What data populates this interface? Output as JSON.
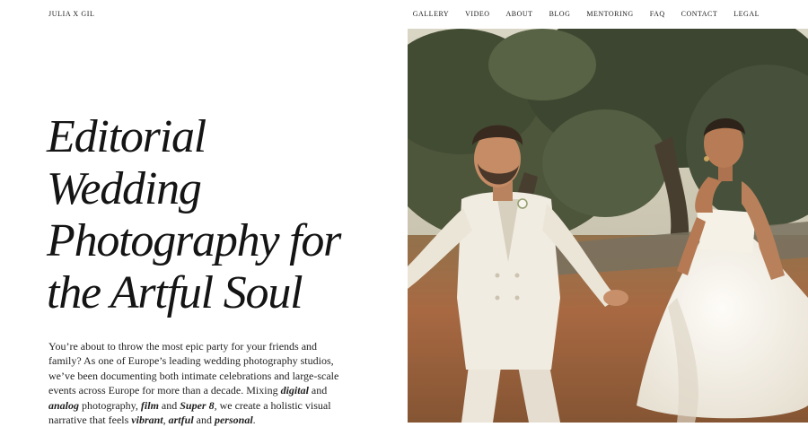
{
  "brand": {
    "logo": "JULIA X GIL"
  },
  "nav": {
    "items": [
      "GALLERY",
      "VIDEO",
      "ABOUT",
      "BLOG",
      "MENTORING",
      "FAQ",
      "CONTACT",
      "LEGAL"
    ]
  },
  "hero": {
    "headline_lines": [
      "Editorial",
      "Wedding",
      "Photography for",
      "the Artful Soul"
    ],
    "intro": {
      "t1": "You’re about to throw the most epic party for your friends and family? As one of Europe’s leading wedding photography studios, we’ve been documenting both intimate celebrations and large-scale events across Europe for more than a decade. Mixing ",
      "e1": "digital",
      "t2": " and ",
      "e2": "analog",
      "t3": " photography, ",
      "e3": "film",
      "t4": " and ",
      "e4": "Super 8",
      "t5": ", we create a holistic visual narrative that feels ",
      "e5": "vibrant",
      "t6": ", ",
      "e6": "artful",
      "t7": " and ",
      "e7": "personal",
      "t8": "."
    },
    "photo": "wedding-couple-photo"
  },
  "colors": {
    "background": "#ffffff",
    "text": "#1b1b1b",
    "foliage": "#3d4a2e",
    "ground": "#9a5a32",
    "suit": "#f1eee6"
  }
}
